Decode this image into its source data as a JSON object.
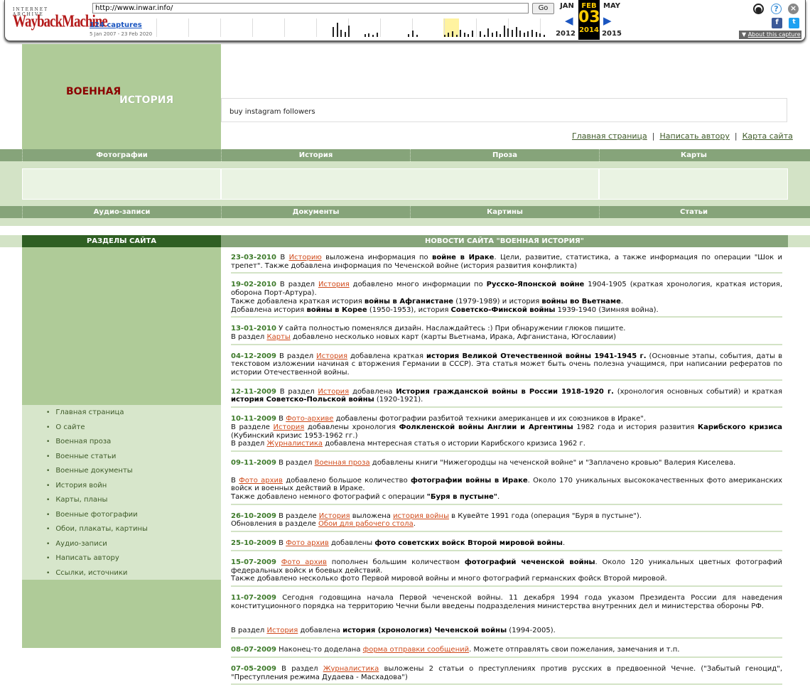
{
  "wayback": {
    "logo_top": "INTERNET ARCHIVE",
    "logo_main": "WaybackMachine",
    "url": "http://www.inwar.info/",
    "go": "Go",
    "captures": "124 captures",
    "range": "5 Jan 2007 - 23 Feb 2020",
    "prev_month": "JAN",
    "cur_month": "FEB",
    "next_month": "MAY",
    "cur_day": "03",
    "prev_year": "2012",
    "cur_year": "2014",
    "next_year": "2015",
    "about": "About this capture",
    "icons": [
      "user-icon",
      "help-icon",
      "close-icon",
      "facebook-icon",
      "twitter-icon"
    ]
  },
  "site": {
    "logo_line1": "ВОЕННАЯ",
    "logo_line2": "ИСТОРИЯ",
    "ad_text": "buy instagram followers",
    "top_links": [
      "Главная страница",
      "Написать автору",
      "Карта сайта"
    ],
    "sep": "|",
    "nav_row1": [
      "Фотографии",
      "История",
      "Проза",
      "Карты"
    ],
    "nav_row2": [
      "Аудио-записи",
      "Документы",
      "Картины",
      "Статьи"
    ],
    "sections_title": "РАЗДЕЛЫ САЙТА",
    "news_title": "НОВОСТИ САЙТА \"ВОЕННАЯ ИСТОРИЯ\"",
    "side_menu": [
      "Главная страница",
      "О сайте",
      "Военная проза",
      "Военные статьи",
      "Военные документы",
      "История войн",
      "Карты, планы",
      "Военные фотографии",
      "Обои, плакаты, картины",
      "Аудио-записи",
      "Написать автору",
      "Ссылки, источники"
    ]
  },
  "colors": {
    "accent_dark": "#2f5f23",
    "band": "#86a47a",
    "side": "#afcb98",
    "date": "#3d7a2a",
    "link": "#d04a1a"
  },
  "news": [
    {
      "date": "23-03-2010",
      "parts": [
        " В ",
        {
          "a": "Историю"
        },
        " выложена информация по ",
        {
          "b": "войне в Ираке"
        },
        ". Цели, развитие, статистика, а также информация по операции \"Шок и трепет\". Также добавлена информация по Чеченской войне (история развития конфликта)"
      ]
    },
    {
      "date": "19-02-2010",
      "parts": [
        " В раздел ",
        {
          "a": "История"
        },
        " добавлено много информации по ",
        {
          "b": "Русско-Японской войне"
        },
        " 1904-1905 (краткая хронология, краткая история, оборона Порт-Артура).",
        {
          "br": 1
        },
        "Также добавлена краткая история ",
        {
          "b": "войны в Афганистане"
        },
        " (1979-1989) и история ",
        {
          "b": "войны во Вьетнаме"
        },
        ".",
        {
          "br": 1
        },
        "Добавлена история ",
        {
          "b": "войны в Корее"
        },
        " (1950-1953), история ",
        {
          "b": "Советско-Финской войны"
        },
        " 1939-1940 (Зимняя война)."
      ]
    },
    {
      "date": "13-01-2010",
      "parts": [
        " У сайта полностью поменялся дизайн. Наслаждайтесь :) При обнаружении глюков пишите.",
        {
          "br": 1
        },
        "В раздел ",
        {
          "a": "Карты"
        },
        " добавлено несколько новых карт (карты Вьетнама, Ирака, Афганистана, Югославии)"
      ]
    },
    {
      "date": "04-12-2009",
      "parts": [
        " В раздел ",
        {
          "a": "История"
        },
        " добавлена краткая ",
        {
          "b": "история Великой Отечественной войны 1941-1945 г."
        },
        " (Основные этапы, события, даты в текстовом изложении начиная с вторжения Германии в СССР). Эта статья может быть очень полезна учащимся, при написании рефератов по истории Отечественной войны."
      ]
    },
    {
      "date": "12-11-2009",
      "parts": [
        " В раздел ",
        {
          "a": "История"
        },
        " добавлена ",
        {
          "b": "История гражданской войны в России 1918-1920 г."
        },
        " (хронология основных событий) и краткая ",
        {
          "b": "история Советско-Польской войны"
        },
        " (1920-1921)."
      ]
    },
    {
      "date": "10-11-2009",
      "parts": [
        " В ",
        {
          "a": "Фото-архиве"
        },
        " добавлены фотографии разбитой техники американцев и их союзников в Ираке\".",
        {
          "br": 1
        },
        "В разделе ",
        {
          "a": "История"
        },
        " добавлены хронология ",
        {
          "b": "Фолкленской войны Англии и Аргентины"
        },
        " 1982 года и история развития ",
        {
          "b": "Карибского кризиса"
        },
        " (Кубинский кризис 1953-1962 гг.)",
        {
          "br": 1
        },
        "В раздел ",
        {
          "a": "Журналистика"
        },
        " добавлена мнтересная статья о истории Карибского кризиса 1962 г."
      ]
    },
    {
      "date": "09-11-2009",
      "parts": [
        " В раздел ",
        {
          "a": "Военная проза"
        },
        " добавлены книги \"Нижегородцы на чеченской войне\" и \"Заплачено кровью\" Валерия Киселева."
      ],
      "nb": true
    },
    {
      "date": "",
      "parts": [
        "В ",
        {
          "a": "Фото архив"
        },
        " добавлено большое количество ",
        {
          "b": "фотографии войны в Ираке"
        },
        ". Около 170 уникальных высококачественных фото американских войск и военных действий в Ираке.",
        {
          "br": 1
        },
        "Также добавлено немного фотографий с операции ",
        {
          "b": "\"Буря в пустыне\""
        },
        "."
      ]
    },
    {
      "date": "26-10-2009",
      "parts": [
        " В разделе ",
        {
          "a": "История"
        },
        " выложена ",
        {
          "a": "история войны"
        },
        " в Кувейте 1991 года (операция \"Буря в пустыне\").",
        {
          "br": 1
        },
        "Обновления в разделе ",
        {
          "a": "Обои для рабочего стола"
        },
        "."
      ]
    },
    {
      "date": "25-10-2009",
      "parts": [
        " В ",
        {
          "a": "Фото архив"
        },
        " добавлены ",
        {
          "b": "фото советских войск Второй мировой войны"
        },
        "."
      ]
    },
    {
      "date": "15-07-2009",
      "parts": [
        " ",
        {
          "a": "Фото архив"
        },
        " пополнен большим количеством ",
        {
          "b": "фотографий чеченской войны"
        },
        ". Около 120 уникальных цветных фотографий федеральных войск и боевых действий.",
        {
          "br": 1
        },
        "Также добавлено несколько фото Первой мировой войны и много фотографий германских фойск Второй мировой."
      ]
    },
    {
      "date": "11-07-2009",
      "parts": [
        " Сегодня годовщина начала Первой чеченской войны. 11 декабря 1994 года указом Президента России для наведения конституционного порядка на территорию Чечни были введены подразделения министерства внутренних дел и министерства обороны РФ."
      ],
      "nb": true,
      "gap": true
    },
    {
      "date": "",
      "parts": [
        "В раздел ",
        {
          "a": "История"
        },
        " добавлена ",
        {
          "b": "история (хронология) Чеченской войны"
        },
        " (1994-2005)."
      ]
    },
    {
      "date": "08-07-2009",
      "parts": [
        " Наконец-то доделана ",
        {
          "a": "форма отправки сообщений"
        },
        ". Можете отправлять свои пожелания, замечания и т.п."
      ]
    },
    {
      "date": "07-05-2009",
      "parts": [
        " В раздел ",
        {
          "a": "Журналистика"
        },
        " выложены 2 статьи о преступлениях против русских в предвоенной Чечне. (\"Забытый геноцид\", \"Преступления режима Дудаева - Масхадова\")"
      ]
    }
  ]
}
